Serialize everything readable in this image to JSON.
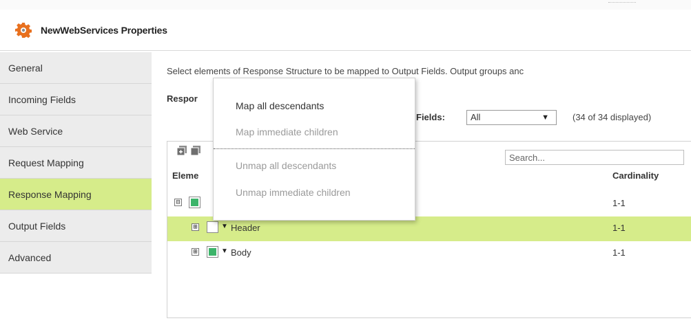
{
  "window": {
    "title": "NewWebServices Properties",
    "icon": "gear-icon",
    "accent_color": "#e8701e"
  },
  "sidebar": {
    "items": [
      {
        "label": "General",
        "active": false
      },
      {
        "label": "Incoming Fields",
        "active": false
      },
      {
        "label": "Web Service",
        "active": false
      },
      {
        "label": "Request Mapping",
        "active": false
      },
      {
        "label": "Response Mapping",
        "active": true
      },
      {
        "label": "Output Fields",
        "active": false
      },
      {
        "label": "Advanced",
        "active": false
      }
    ],
    "active_color": "#d6ec8a"
  },
  "main": {
    "description": "Select elements of Response Structure to be mapped to Output Fields. Output groups anc",
    "response_label": "Respor",
    "fields_filter": {
      "label": "Fields:",
      "selected": "All"
    },
    "displayed_count": "(34 of 34 displayed)",
    "search": {
      "placeholder": "Search..."
    },
    "columns": {
      "element": "Eleme",
      "cardinality": "Cardinality"
    },
    "rows": [
      {
        "name": "",
        "cardinality": "1-1",
        "expander": "⊟",
        "checked": true,
        "selected": false
      },
      {
        "name": "Header",
        "cardinality": "1-1",
        "expander": "⊞",
        "checked": false,
        "selected": true
      },
      {
        "name": "Body",
        "cardinality": "1-1",
        "expander": "⊞",
        "checked": true,
        "selected": false
      }
    ]
  },
  "context_menu": {
    "items": [
      {
        "label": "Map all descendants",
        "enabled": true
      },
      {
        "label": "Map immediate children",
        "enabled": false
      },
      {
        "label": "Unmap all descendants",
        "enabled": false
      },
      {
        "label": "Unmap immediate children",
        "enabled": false
      }
    ]
  }
}
